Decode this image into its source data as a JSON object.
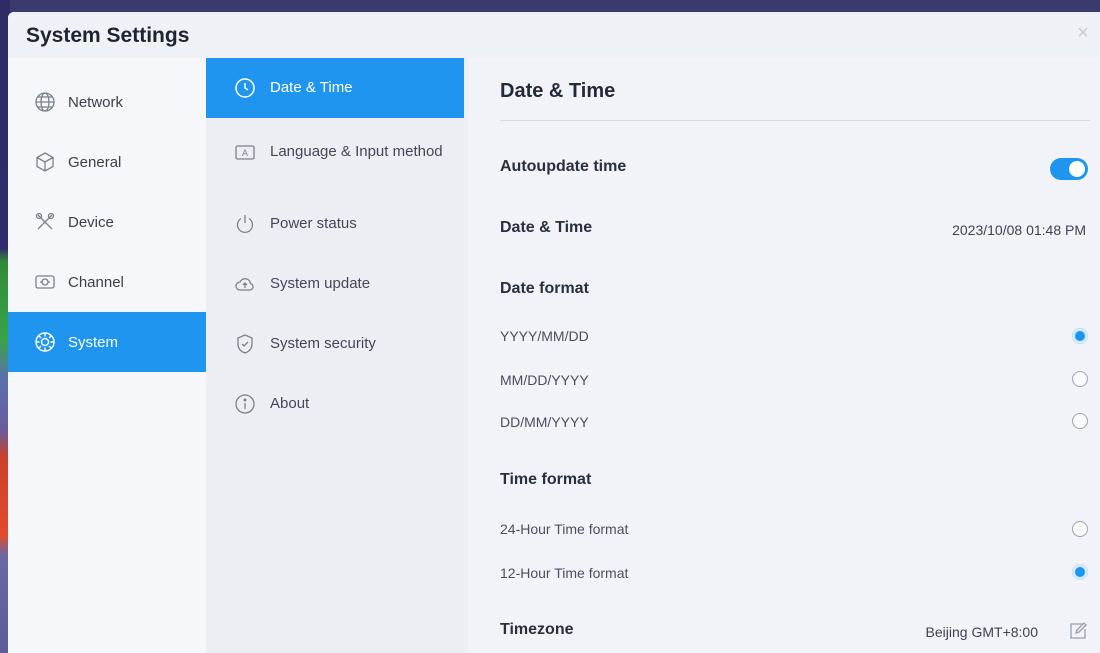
{
  "window": {
    "title": "System Settings",
    "close_glyph": "×"
  },
  "sidebar": {
    "items": [
      {
        "label": "Network",
        "icon": "globe-icon",
        "active": false
      },
      {
        "label": "General",
        "icon": "cube-icon",
        "active": false
      },
      {
        "label": "Device",
        "icon": "tools-icon",
        "active": false
      },
      {
        "label": "Channel",
        "icon": "input-port-icon",
        "active": false
      },
      {
        "label": "System",
        "icon": "system-gear-icon",
        "active": true
      }
    ]
  },
  "submenu": {
    "items": [
      {
        "label": "Date & Time",
        "icon": "clock-icon",
        "active": true
      },
      {
        "label": "Language & Input method",
        "icon": "keyboard-icon",
        "active": false
      },
      {
        "label": "Power status",
        "icon": "power-icon",
        "active": false
      },
      {
        "label": "System update",
        "icon": "cloud-upload-icon",
        "active": false
      },
      {
        "label": "System security",
        "icon": "shield-icon",
        "active": false
      },
      {
        "label": "About",
        "icon": "info-icon",
        "active": false
      }
    ]
  },
  "content": {
    "title": "Date & Time",
    "autoupdate": {
      "label": "Autoupdate time",
      "enabled": true
    },
    "datetime": {
      "label": "Date & Time",
      "value": "2023/10/08 01:48 PM"
    },
    "date_format": {
      "label": "Date format",
      "options": [
        {
          "label": "YYYY/MM/DD",
          "selected": true
        },
        {
          "label": "MM/DD/YYYY",
          "selected": false
        },
        {
          "label": "DD/MM/YYYY",
          "selected": false
        }
      ]
    },
    "time_format": {
      "label": "Time format",
      "options": [
        {
          "label": "24-Hour Time format",
          "selected": false
        },
        {
          "label": "12-Hour Time format",
          "selected": true
        }
      ]
    },
    "timezone": {
      "label": "Timezone",
      "value": "Beijing GMT+8:00"
    }
  },
  "colors": {
    "accent": "#1f95f0",
    "window_bg": "#f2f4f8"
  }
}
